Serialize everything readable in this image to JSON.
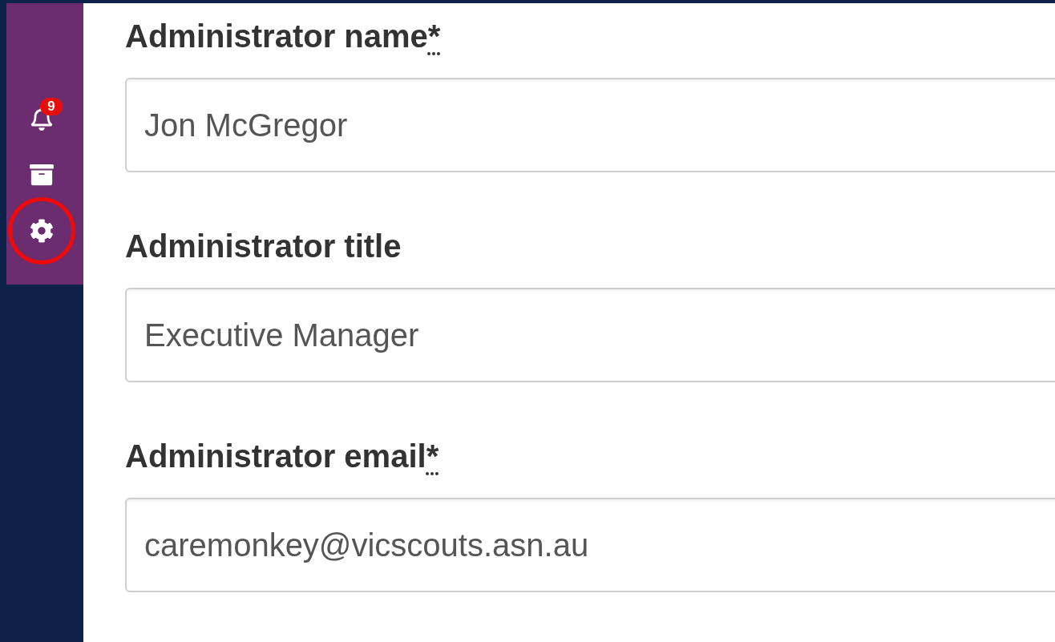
{
  "sidebar": {
    "items": [
      {
        "kind": "notifications",
        "badge": "9",
        "circled": false
      },
      {
        "kind": "archive",
        "circled": false
      },
      {
        "kind": "settings",
        "circled": true
      }
    ]
  },
  "form": {
    "fields": [
      {
        "label": "Administrator name",
        "required_mark": "*",
        "value": "Jon McGregor"
      },
      {
        "label": "Administrator title",
        "value": "Executive Manager"
      },
      {
        "label": "Administrator email",
        "required_mark": "*",
        "value": "caremonkey@vicscouts.asn.au"
      }
    ]
  }
}
